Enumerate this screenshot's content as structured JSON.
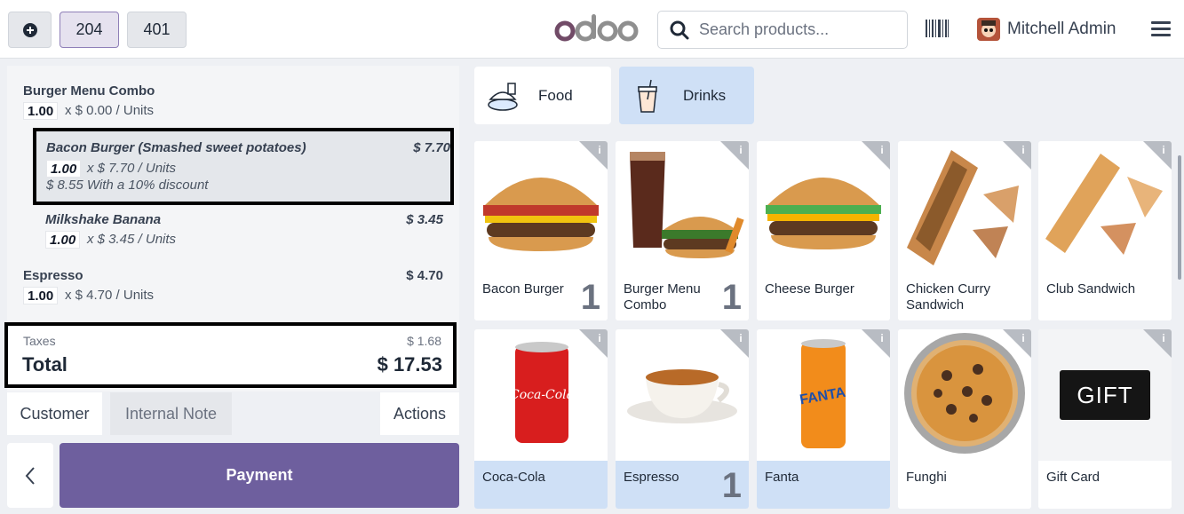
{
  "header": {
    "new_order_icon": "plus-circle-icon",
    "order_tabs": [
      "204",
      "401"
    ],
    "active_tab": "204",
    "logo_text": "odoo",
    "search_placeholder": "Search products...",
    "user_name": "Mitchell Admin"
  },
  "order": {
    "lines": [
      {
        "name": "Burger Menu Combo",
        "qty": "1.00",
        "unit": "x $ 0.00 / Units",
        "price": ""
      },
      {
        "name": "Bacon Burger (Smashed sweet potatoes)",
        "qty": "1.00",
        "unit": "x $ 7.70 / Units",
        "price": "$ 7.70",
        "discount": "$ 8.55 With a 10% discount"
      },
      {
        "name": "Milkshake Banana",
        "qty": "1.00",
        "unit": "x $ 3.45 / Units",
        "price": "$ 3.45"
      },
      {
        "name": "Espresso",
        "qty": "1.00",
        "unit": "x $ 4.70 / Units",
        "price": "$ 4.70"
      }
    ],
    "taxes_label": "Taxes",
    "taxes_value": "$ 1.68",
    "total_label": "Total",
    "total_value": "$ 17.53"
  },
  "controls": {
    "customer": "Customer",
    "internal_note": "Internal Note",
    "actions": "Actions",
    "payment": "Payment"
  },
  "categories": [
    {
      "label": "Food",
      "icon": "food-icon",
      "active": false
    },
    {
      "label": "Drinks",
      "icon": "drinks-icon",
      "active": true
    }
  ],
  "products": [
    {
      "name": "Bacon Burger",
      "qty": "1",
      "icon": "burger-image",
      "selected": false
    },
    {
      "name": "Burger Menu Combo",
      "qty": "1",
      "icon": "combo-image",
      "selected": false
    },
    {
      "name": "Cheese Burger",
      "qty": "",
      "icon": "burger-image",
      "selected": false
    },
    {
      "name": "Chicken Curry Sandwich",
      "qty": "",
      "icon": "sandwich-image",
      "selected": false
    },
    {
      "name": "Club Sandwich",
      "qty": "",
      "icon": "sandwich-image",
      "selected": false
    },
    {
      "name": "Coca-Cola",
      "qty": "",
      "icon": "can-image",
      "selected": true
    },
    {
      "name": "Espresso",
      "qty": "1",
      "icon": "coffee-image",
      "selected": true
    },
    {
      "name": "Fanta",
      "qty": "",
      "icon": "can-image",
      "selected": true
    },
    {
      "name": "Funghi",
      "qty": "",
      "icon": "pizza-image",
      "selected": false
    },
    {
      "name": "Gift Card",
      "qty": "",
      "icon": "gift-card-image",
      "selected": false
    }
  ],
  "gift_card_text": "GIFT",
  "colors": {
    "accent": "#6e5f9e",
    "selected_tile": "#cfe0f6",
    "active_category": "#cfe0f6"
  }
}
